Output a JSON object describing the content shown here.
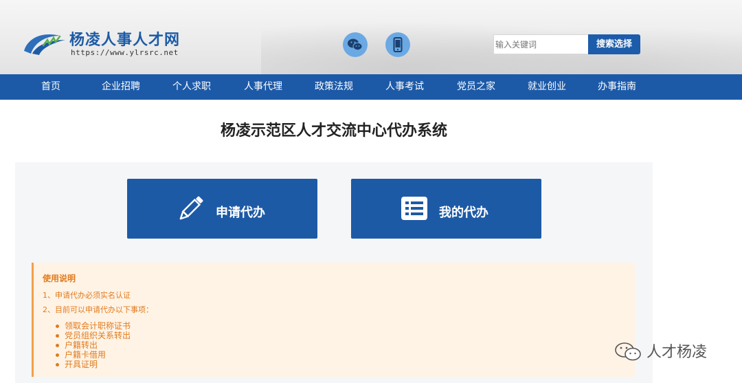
{
  "header": {
    "logo_title": "杨凌人事人才网",
    "logo_url": "https://www.ylrsrc.net",
    "icons": [
      "wechat-icon",
      "mobile-icon"
    ],
    "search_placeholder": "输入关键词",
    "search_button": "搜索选择"
  },
  "nav": {
    "items": [
      {
        "label": "首页"
      },
      {
        "label": "企业招聘"
      },
      {
        "label": "个人求职"
      },
      {
        "label": "人事代理"
      },
      {
        "label": "政策法规"
      },
      {
        "label": "人事考试"
      },
      {
        "label": "党员之家"
      },
      {
        "label": "就业创业"
      },
      {
        "label": "办事指南"
      }
    ]
  },
  "main": {
    "title": "杨凌示范区人才交流中心代办系统",
    "buttons": [
      {
        "label": "申请代办",
        "icon": "pencil-icon"
      },
      {
        "label": "我的代办",
        "icon": "list-icon"
      }
    ],
    "notice": {
      "title": "使用说明",
      "line1": "1、申请代办必须实名认证",
      "line2": "2、目前可以申请代办以下事项：",
      "items": [
        "领取会计职称证书",
        "党员组织关系转出",
        "户籍转出",
        "户籍卡借用",
        "开具证明"
      ]
    }
  },
  "watermark": {
    "text": "人才杨凌",
    "icon": "wechat-outline-icon"
  },
  "colors": {
    "brand_blue": "#1c5aa8",
    "icon_circle": "#6aa9e3",
    "notice_bg": "#fff3e6",
    "notice_text": "#e07b1c",
    "notice_border": "#f0a04b"
  }
}
